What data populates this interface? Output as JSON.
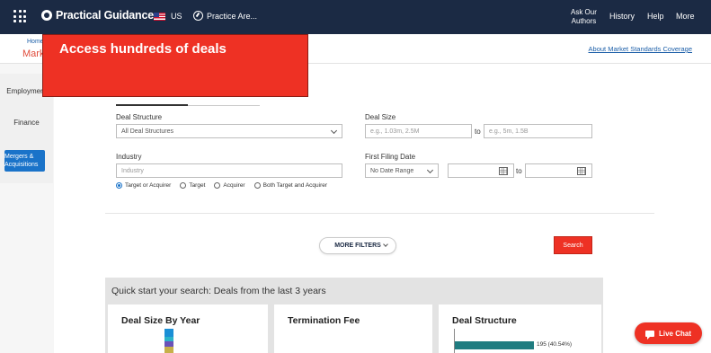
{
  "nav": {
    "brand": "Practical Guidance",
    "country": "US",
    "practice_area": "Practice Are...",
    "links": [
      "Ask Our Authors",
      "History",
      "Help",
      "More"
    ],
    "ask_line1": "Ask Our",
    "ask_line2": "Authors"
  },
  "subbar": {
    "breadcrumb_home": "Home",
    "page_title_partial": "Mark",
    "coverage_link": "About Market Standards Coverage"
  },
  "banner": {
    "text": "Access hundreds of deals"
  },
  "sidebar": {
    "items": [
      "Employment",
      "Finance"
    ],
    "active_line1": "Mergers &",
    "active_line2": "Acquisitions"
  },
  "form": {
    "deal_structure_label": "Deal Structure",
    "deal_structure_value": "All Deal Structures",
    "deal_size_label": "Deal Size",
    "deal_size_min_placeholder": "e.g., 1.03m, 2.5M",
    "deal_size_max_placeholder": "e.g., 5m, 1.5B",
    "to": "to",
    "industry_label": "Industry",
    "industry_placeholder": "Industry",
    "filing_date_label": "First Filing Date",
    "date_range_value": "No Date Range",
    "radio_options": [
      "Target or Acquirer",
      "Target",
      "Acquirer",
      "Both Target and Acquirer"
    ],
    "radio_selected": "Target or Acquirer",
    "more_filters": "MORE FILTERS",
    "search": "Search"
  },
  "quick_start": {
    "title": "Quick start your search: Deals from the last 3 years",
    "cards": [
      {
        "title": "Deal Size By Year"
      },
      {
        "title": "Termination Fee"
      },
      {
        "title": "Deal Structure"
      }
    ],
    "deal_structure_bar_label": "195 (40.54%)",
    "deal_structure_bar_value": 195,
    "deal_structure_bar_percent": 40.54
  },
  "live_chat": "Live Chat",
  "colors": {
    "nav_bg": "#1b2a44",
    "accent_red": "#ee3124",
    "link_blue": "#1b5ea8",
    "active_blue": "#1a73c9",
    "bar_teal": "#1f7c80"
  }
}
